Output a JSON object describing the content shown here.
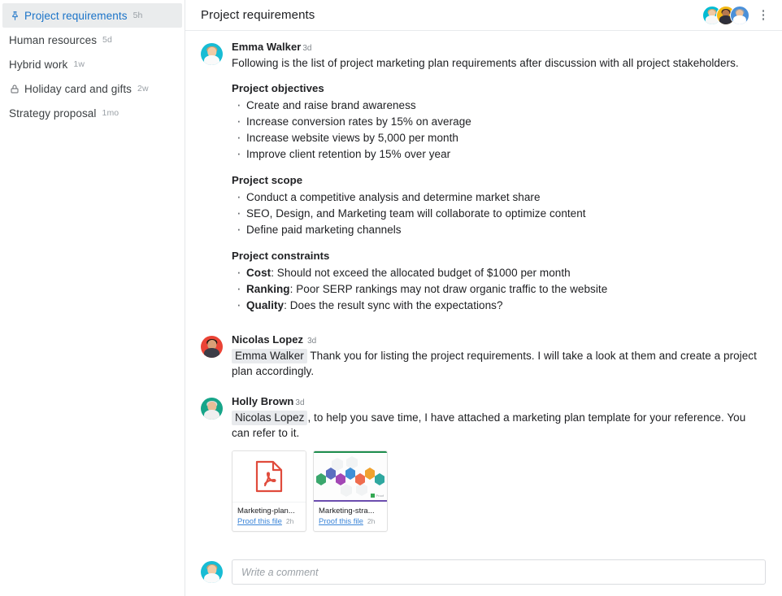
{
  "sidebar": {
    "items": [
      {
        "icon": "pin-icon",
        "title": "Project requirements",
        "time": "5h",
        "active": true
      },
      {
        "icon": "none",
        "title": "Human resources",
        "time": "5d",
        "active": false
      },
      {
        "icon": "none",
        "title": "Hybrid work",
        "time": "1w",
        "active": false
      },
      {
        "icon": "lock-icon",
        "title": "Holiday card and gifts",
        "time": "2w",
        "active": false
      },
      {
        "icon": "none",
        "title": "Strategy proposal",
        "time": "1mo",
        "active": false
      }
    ]
  },
  "topbar": {
    "title": "Project requirements",
    "participants": [
      {
        "name": "participant-1",
        "bg": "#00bcd4"
      },
      {
        "name": "participant-2",
        "bg": "#f5b914"
      },
      {
        "name": "participant-3",
        "bg": "#4a90d9"
      }
    ],
    "menu_label": "more-options"
  },
  "messages": [
    {
      "author": "Emma Walker",
      "time": "3d",
      "avatar_bg": "#18bcd4",
      "intro": "Following is the list of project marketing plan requirements after discussion with all project stakeholders.",
      "sections": [
        {
          "title": "Project objectives",
          "items": [
            {
              "label": "",
              "text": "Create and raise brand awareness"
            },
            {
              "label": "",
              "text": "Increase conversion rates by 15% on average"
            },
            {
              "label": "",
              "text": "Increase website views by 5,000 per month"
            },
            {
              "label": "",
              "text": "Improve client retention by 15% over year"
            }
          ]
        },
        {
          "title": "Project scope",
          "items": [
            {
              "label": "",
              "text": "Conduct a competitive analysis and determine market share"
            },
            {
              "label": "",
              "text": "SEO, Design, and Marketing team will collaborate to optimize content"
            },
            {
              "label": "",
              "text": "Define paid marketing channels"
            }
          ]
        },
        {
          "title": "Project constraints",
          "items": [
            {
              "label": "Cost",
              "text": ": Should not exceed the allocated budget of $1000 per month"
            },
            {
              "label": "Ranking",
              "text": ": Poor SERP rankings may not draw organic traffic to the website"
            },
            {
              "label": "Quality",
              "text": ": Does the result sync with the expectations?"
            }
          ]
        }
      ]
    },
    {
      "author": "Nicolas Lopez",
      "time": "3d",
      "avatar_bg": "#ea4335",
      "mention": "Emma Walker",
      "body": " Thank you for listing the project requirements. I will take a look at them and create a project plan accordingly."
    },
    {
      "author": "Holly Brown",
      "time": "3d",
      "avatar_bg": "#17a589",
      "mention": "Nicolas Lopez",
      "body": ", to help you save time, I have attached a marketing plan template for your reference. You can refer to it."
    }
  ],
  "attachments": [
    {
      "kind": "pdf",
      "name": "Marketing-plan...",
      "action": "Proof this file",
      "age": "2h",
      "icon": "pdf-file-icon"
    },
    {
      "kind": "slide",
      "name": "Marketing-stra...",
      "action": "Proof this file",
      "age": "2h",
      "icon": "slide-thumbnail",
      "hex_colors": [
        "#3aa76d",
        "#5b6fc0",
        "#a347b5",
        "#3f90d6",
        "#ef6c4d",
        "#f0a22e",
        "#2fa8a0"
      ],
      "badge_text": "Proof"
    }
  ],
  "composer": {
    "avatar_bg": "#18bcd4",
    "placeholder": "Write a comment",
    "value": ""
  }
}
